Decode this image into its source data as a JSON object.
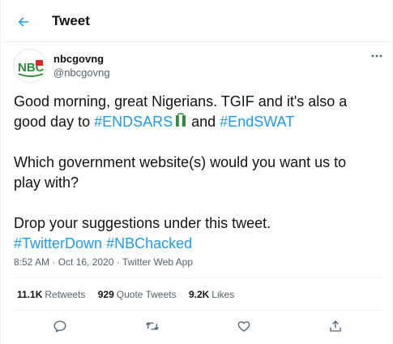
{
  "header": {
    "title": "Tweet"
  },
  "author": {
    "name": "nbcgovng",
    "handle": "@nbcgovng",
    "avatar_text": "NBC"
  },
  "tweet": {
    "line1_a": "Good morning, great Nigerians. TGIF and it's also a",
    "line2_a": "good day to ",
    "hashtag_endsars": "#ENDSARS",
    "line2_b": " and ",
    "hashtag_endswat": "#EndSWAT",
    "line3": "Which government website(s) would you want us to",
    "line4": "play with?",
    "line5": "Drop your suggestions under this tweet.",
    "hashtag_twitterdown": "#TwitterDown",
    "hashtag_nbchacked": "#NBChacked",
    "emoji": "nigeria-fist-emoji"
  },
  "meta": {
    "timestamp": "8:52 AM · Oct 16, 2020",
    "separator": " · ",
    "source": "Twitter Web App"
  },
  "stats": {
    "retweets_count": "11.1K",
    "retweets_label": "Retweets",
    "quote_count": "929",
    "quote_label": "Quote Tweets",
    "likes_count": "9.2K",
    "likes_label": "Likes"
  },
  "icons": [
    "back-arrow-icon",
    "more-icon",
    "reply-icon",
    "retweet-icon",
    "like-icon",
    "share-icon"
  ],
  "colors": {
    "accent": "#1d9bf0",
    "muted": "#536471",
    "text": "#0f1419",
    "nbc_green": "#2e8b3a",
    "nbc_red": "#d9252a"
  }
}
